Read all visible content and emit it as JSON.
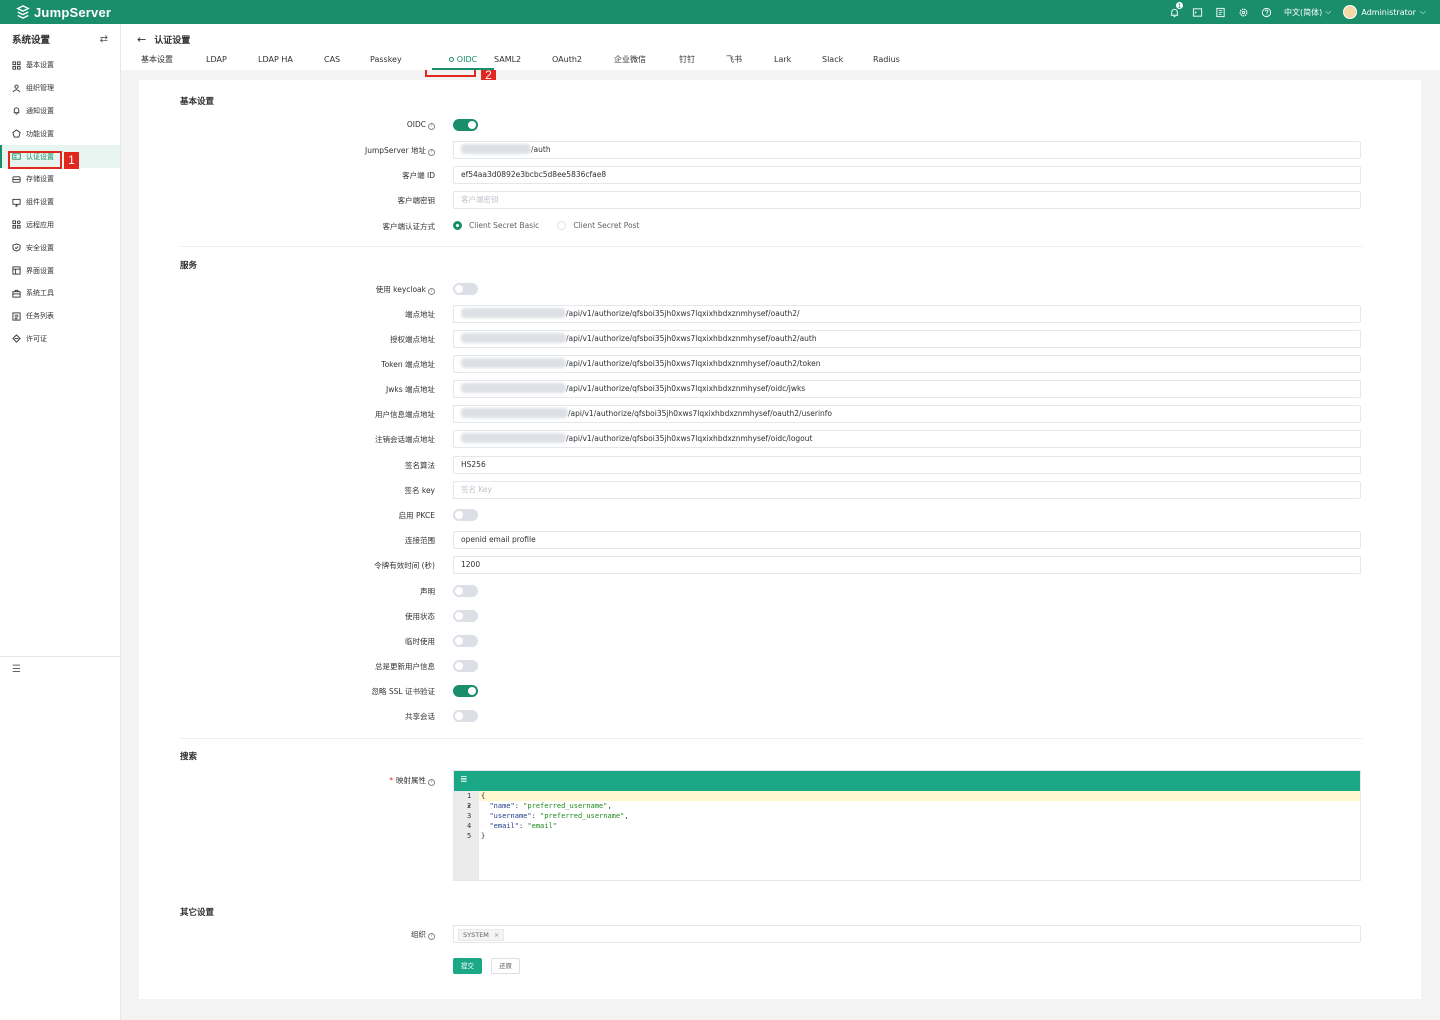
{
  "app": {
    "name": "JumpServer"
  },
  "topbar": {
    "notifications_count": "1",
    "language": "中文(简体)",
    "user": "Administrator"
  },
  "sidebar": {
    "title": "系统设置",
    "items": [
      {
        "label": "基本设置",
        "icon": "grid-icon"
      },
      {
        "label": "组织管理",
        "icon": "org-icon"
      },
      {
        "label": "通知设置",
        "icon": "bell-icon"
      },
      {
        "label": "功能设置",
        "icon": "feature-icon"
      },
      {
        "label": "认证设置",
        "icon": "id-card-icon",
        "active": true
      },
      {
        "label": "存储设置",
        "icon": "storage-icon"
      },
      {
        "label": "组件设置",
        "icon": "monitor-icon"
      },
      {
        "label": "远程应用",
        "icon": "apps-icon"
      },
      {
        "label": "安全设置",
        "icon": "shield-icon"
      },
      {
        "label": "界面设置",
        "icon": "layout-icon"
      },
      {
        "label": "系统工具",
        "icon": "toolbox-icon"
      },
      {
        "label": "任务列表",
        "icon": "list-icon"
      },
      {
        "label": "许可证",
        "icon": "license-icon"
      }
    ]
  },
  "annotations": {
    "one": "1",
    "two": "2"
  },
  "page": {
    "title": "认证设置"
  },
  "tabs": [
    "基本设置",
    "LDAP",
    "LDAP HA",
    "CAS",
    "Passkey",
    "OIDC",
    "SAML2",
    "OAuth2",
    "企业微信",
    "钉钉",
    "飞书",
    "Lark",
    "Slack",
    "Radius"
  ],
  "form": {
    "basic": {
      "title": "基本设置",
      "oidc_label": "OIDC",
      "oidc_enabled": true,
      "js_url_label": "JumpServer 地址",
      "js_url_suffix": "/auth",
      "client_id_label": "客户端 ID",
      "client_id": "ef54aa3d0892e3bcbc5d8ee5836cfae8",
      "client_secret_label": "客户端密钥",
      "client_secret_placeholder": "客户端密钥",
      "auth_method_label": "客户端认证方式",
      "auth_methods": [
        "Client Secret Basic",
        "Client Secret Post"
      ],
      "auth_method_selected": "Client Secret Basic"
    },
    "service": {
      "title": "服务",
      "keycloak_label": "使用 keycloak",
      "endpoint_label": "端点地址",
      "endpoint": "/api/v1/authorize/qfsboi35jh0xws7lqxixhbdxznmhysef/oauth2/",
      "auth_endpoint_label": "授权端点地址",
      "auth_endpoint": "/api/v1/authorize/qfsboi35jh0xws7lqxixhbdxznmhysef/oauth2/auth",
      "token_endpoint_label": "Token 端点地址",
      "token_endpoint": "/api/v1/authorize/qfsboi35jh0xws7lqxixhbdxznmhysef/oauth2/token",
      "jwks_endpoint_label": "Jwks 端点地址",
      "jwks_endpoint": "/api/v1/authorize/qfsboi35jh0xws7lqxixhbdxznmhysef/oidc/jwks",
      "userinfo_endpoint_label": "用户信息端点地址",
      "userinfo_endpoint": "/api/v1/authorize/qfsboi35jh0xws7lqxixhbdxznmhysef/oauth2/userinfo",
      "logout_endpoint_label": "注销会话端点地址",
      "logout_endpoint": "/api/v1/authorize/qfsboi35jh0xws7lqxixhbdxznmhysef/oidc/logout",
      "sign_algo_label": "签名算法",
      "sign_algo": "HS256",
      "sign_key_label": "签名 key",
      "sign_key_placeholder": "签名 Key",
      "pkce_label": "启用 PKCE",
      "scope_label": "连接范围",
      "scope": "openid email profile",
      "token_ttl_label": "令牌有效时间 (秒)",
      "token_ttl": "1200",
      "claim_label": "声明",
      "use_state_label": "使用状态",
      "nonce_label": "临时使用",
      "always_update_label": "总是更新用户信息",
      "ignore_ssl_label": "忽略 SSL 证书验证",
      "share_session_label": "共享会话"
    },
    "search": {
      "title": "搜索",
      "mapping_label": "映射属性",
      "code_lines": [
        "{",
        "  \"name\": \"preferred_username\",",
        "  \"username\": \"preferred_username\",",
        "  \"email\": \"email\"",
        "}"
      ]
    },
    "other": {
      "title": "其它设置",
      "org_label": "组织",
      "org_tag": "SYSTEM",
      "submit": "提交",
      "reset": "还原"
    }
  },
  "colors": {
    "brand": "#1a8e6b",
    "editor_bar": "#1ba886",
    "annotation": "#e0281f"
  }
}
